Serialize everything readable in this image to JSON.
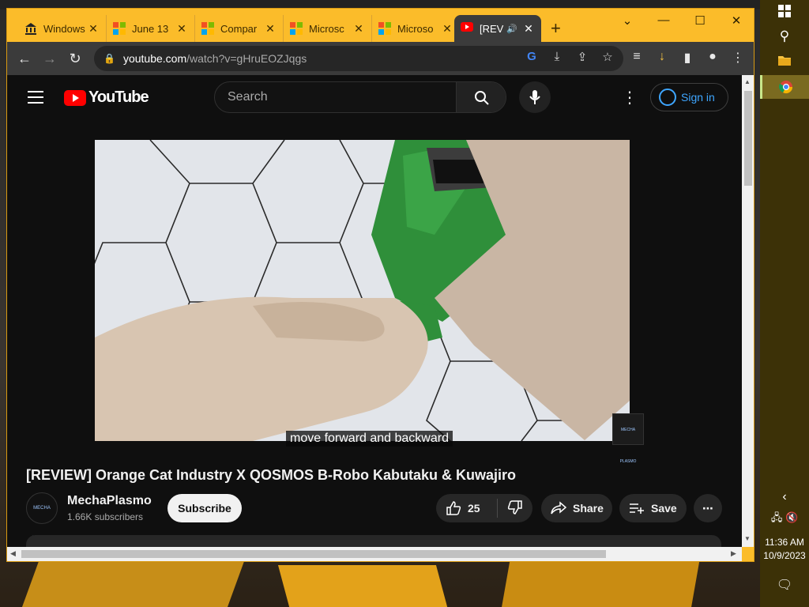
{
  "browser": {
    "tabs": [
      {
        "title": "Windows",
        "favicon": "bank-icon",
        "active": false
      },
      {
        "title": "June 13",
        "favicon": "microsoft-icon",
        "active": false
      },
      {
        "title": "Compar",
        "favicon": "microsoft-icon",
        "active": false
      },
      {
        "title": "Microsc",
        "favicon": "microsoft-icon",
        "active": false
      },
      {
        "title": "Microso",
        "favicon": "microsoft-icon",
        "active": false
      },
      {
        "title": "[REV",
        "favicon": "youtube-icon",
        "active": true,
        "audio": true
      }
    ],
    "new_tab_label": "+",
    "url_host": "youtube.com",
    "url_path": "/watch?v=gHruEOZJqgs",
    "frame_color": "#fbbc2a"
  },
  "youtube": {
    "logo_text": "YouTube",
    "search_placeholder": "Search",
    "signin_label": "Sign in",
    "caption": "move forward and backward",
    "watermark": "MECHA PLASMO",
    "video_title": "[REVIEW] Orange Cat Industry X QOSMOS B-Robo Kabutaku & Kuwajiro",
    "channel_name": "MechaPlasmo",
    "channel_subs": "1.66K subscribers",
    "subscribe_label": "Subscribe",
    "like_count": "25",
    "share_label": "Share",
    "save_label": "Save",
    "accent": "#3ea6ff"
  },
  "taskbar": {
    "time": "11:36 AM",
    "date": "10/9/2023"
  }
}
